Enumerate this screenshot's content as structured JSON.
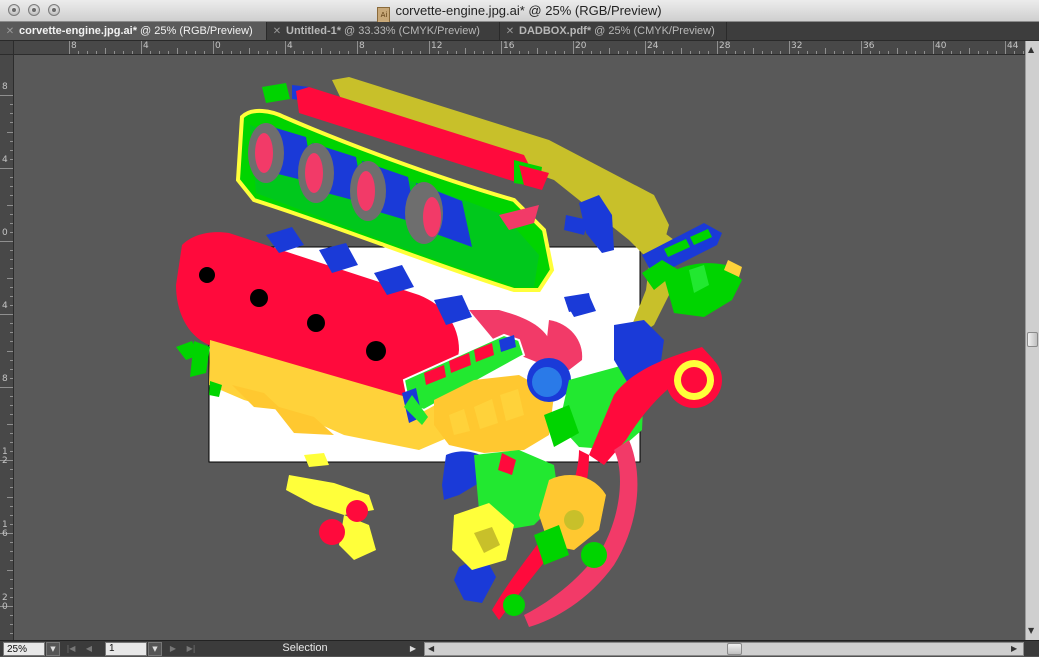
{
  "window": {
    "title": "corvette-engine.jpg.ai* @ 25% (RGB/Preview)",
    "doc_icon_label": "Ai"
  },
  "tabs": [
    {
      "name": "corvette-engine.jpg.ai*",
      "suffix": " @ 25% (RGB/Preview)",
      "active": true
    },
    {
      "name": "Untitled-1*",
      "suffix": " @ 33.33% (CMYK/Preview)",
      "active": false
    },
    {
      "name": "DADBOX.pdf*",
      "suffix": " @ 25% (CMYK/Preview)",
      "active": false
    }
  ],
  "rulers": {
    "top_labels": [
      "8",
      "4",
      "0",
      "4",
      "8",
      "12",
      "16",
      "20",
      "24",
      "28",
      "32",
      "36",
      "40",
      "44"
    ],
    "left_labels": [
      "8",
      "4",
      "0",
      "4",
      "8",
      "12",
      "16",
      "20"
    ]
  },
  "status": {
    "zoom": "25%",
    "page": "1",
    "tool": "Selection"
  },
  "icons": {
    "close": "close-icon",
    "dropdown": "chevron-down-icon",
    "first": "first-page-icon",
    "prev": "prev-page-icon",
    "next": "next-page-icon",
    "last": "last-page-icon"
  },
  "colors": {
    "pasteboard": "#595959",
    "artboard": "#ffffff",
    "red": "#ff0a3c",
    "pink": "#f23a68",
    "green": "#00d400",
    "bright_green": "#22e830",
    "blue": "#1a3ad8",
    "yellow": "#ffd23a",
    "lemon": "#ffff3a",
    "olive": "#c8c02a",
    "orange": "#ffc830"
  }
}
